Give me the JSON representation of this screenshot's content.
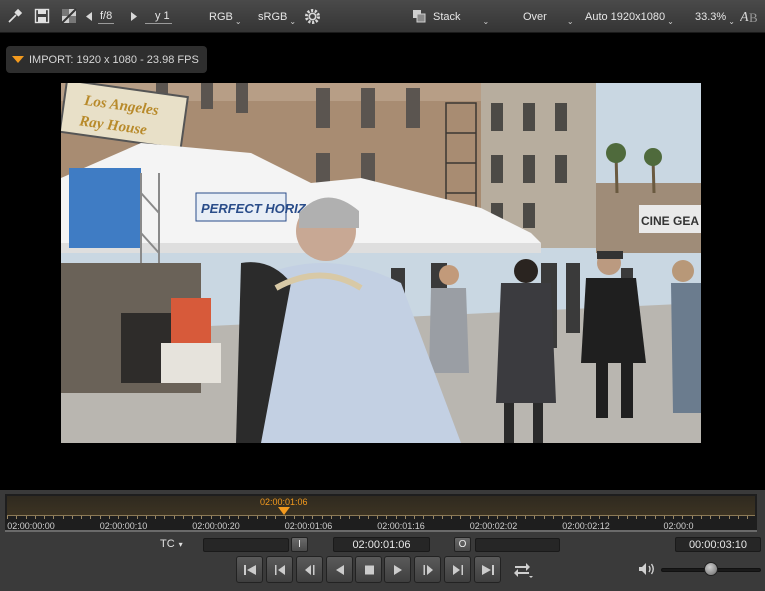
{
  "toolbar": {
    "aperture": "f/8",
    "channel": "y 1",
    "color_mode": "RGB",
    "color_space": "sRGB",
    "composite_mode": "Stack",
    "overlay_mode": "Over",
    "resolution": "Auto 1920x1080",
    "zoom": "33.3%",
    "icons": [
      "eyedropper-icon",
      "save-icon",
      "checker-icon",
      "gear-icon",
      "stack-icon",
      "ab-icon"
    ]
  },
  "viewer": {
    "clip_label": "IMPORT: 1920 x  1080 - 23.98 FPS",
    "frame_signs": [
      "Los Angeles",
      "Ray House",
      "PERFECT HORIZON",
      "CINE GEA"
    ]
  },
  "timeline": {
    "playhead_timecode": "02:00:01:06",
    "playhead_fraction": 0.37,
    "tick_labels": [
      "02:00:00:00",
      "02:00:00:10",
      "02:00:00:20",
      "02:00:01:06",
      "02:00:01:16",
      "02:00:02:02",
      "02:00:02:12",
      "02:00:0"
    ]
  },
  "transport": {
    "tc_mode": "TC",
    "in_label": "I",
    "out_label": "O",
    "current_timecode": "02:00:01:06",
    "duration": "00:00:03:10",
    "volume_level": 0.5,
    "buttons": [
      "go-to-start-button",
      "previous-edit-button",
      "step-back-button",
      "play-reverse-button",
      "stop-button",
      "play-button",
      "step-forward-button",
      "next-edit-button",
      "go-to-end-button"
    ]
  },
  "colors": {
    "accent": "#f39a1e",
    "toolbar_bg": "#404040",
    "panel_bg": "#3a3a3a"
  }
}
